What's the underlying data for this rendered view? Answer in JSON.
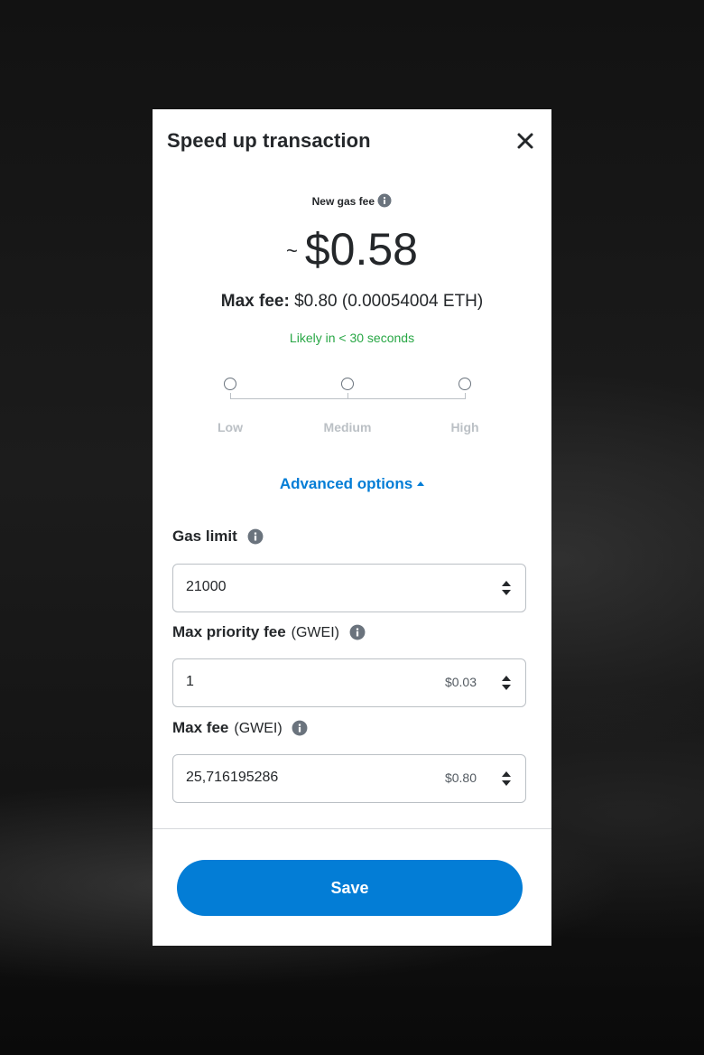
{
  "modal": {
    "title": "Speed up transaction"
  },
  "gas_fee": {
    "label": "New gas fee",
    "tilde": "~",
    "amount": "$0.58",
    "max_fee_label": "Max fee:",
    "max_fee_value": "$0.80 (0.00054004 ETH)",
    "likely_text": "Likely in < 30 seconds"
  },
  "slider": {
    "options": [
      "Low",
      "Medium",
      "High"
    ]
  },
  "advanced_options": {
    "label": "Advanced options"
  },
  "fields": {
    "gas_limit": {
      "label": "Gas limit",
      "value": "21000"
    },
    "max_priority_fee": {
      "label": "Max priority fee",
      "unit": "(GWEI)",
      "value": "1",
      "fiat": "$0.03"
    },
    "max_fee": {
      "label": "Max fee",
      "unit": "(GWEI)",
      "value": "25,716195286",
      "fiat": "$0.80"
    }
  },
  "footer": {
    "save_label": "Save"
  },
  "colors": {
    "accent": "#037dd6",
    "success": "#28a745",
    "text": "#24272a",
    "muted": "#bbc0c5"
  },
  "icons": {
    "close": "close-icon",
    "info": "info-icon",
    "caret": "caret-up-icon",
    "stepper": "stepper-icon"
  }
}
